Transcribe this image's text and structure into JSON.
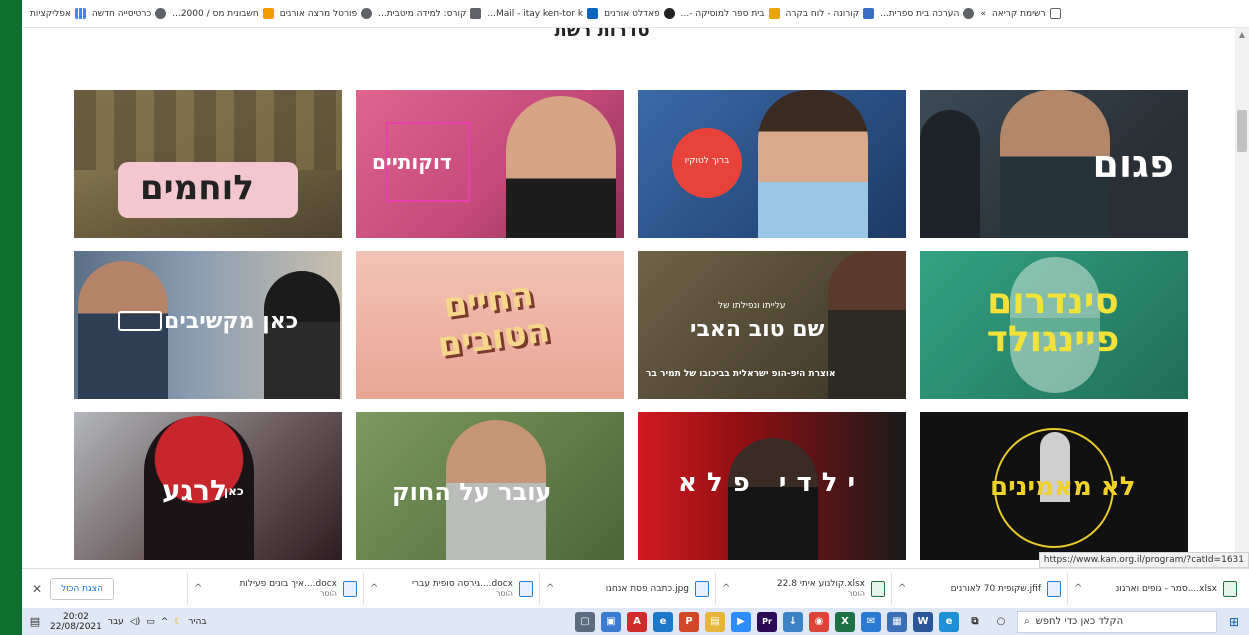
{
  "bookmarks": [
    {
      "label": "אפליקציות",
      "color": "#f4b400"
    },
    {
      "label": "כרטיסייה חדשה",
      "color": "#4285f4"
    },
    {
      "label": "חשבונית מס / 2000...",
      "color": "#f29900"
    },
    {
      "label": "פורטל מרצה אורנים",
      "color": "#5f6368"
    },
    {
      "label": "קורס: למידה מיטבית...",
      "color": "#5f6368"
    },
    {
      "label": "Mail - itay ken-tor k...",
      "color": "#0a64c2"
    },
    {
      "label": "פאדלט אורנים",
      "color": "#222222"
    },
    {
      "label": "בית ספר למוסיקה -...",
      "color": "#e8a400"
    },
    {
      "label": "קורונה - לוח בקרה",
      "color": "#3b6fc4"
    },
    {
      "label": "הערכה בית ספרית...",
      "color": "#5f6368"
    }
  ],
  "bookmarks_more": "»",
  "reading_list": "רשימת קריאה",
  "section_title": "סדרות רשת",
  "tiles": [
    {
      "title": "פגום",
      "bg1": "#3b4b57",
      "bg2": "#2a2f35"
    },
    {
      "title": "ברוך לטוקיו",
      "bg1": "#3a6aa8",
      "bg2": "#1e3a66"
    },
    {
      "title": "דוקותיים",
      "bg1": "#d84f86",
      "bg2": "#222222"
    },
    {
      "title": "לוחמים",
      "bg1": "#8a7b55",
      "bg2": "#5a4d33"
    },
    {
      "title": "סינדרום פיינגולד",
      "bg1": "#2f9a7c",
      "bg2": "#1f6e58"
    },
    {
      "title": "שם טוב האבי",
      "subtitle": "עלייתו ונפילתו של",
      "caption": "אוצרת היפ-הופ ישראלית בביכובו של תמיר בר",
      "bg1": "#6e6247",
      "bg2": "#3a3324"
    },
    {
      "title": "החיים הטובים",
      "bg1": "#f1b9ad",
      "bg2": "#e59b8f"
    },
    {
      "title": "כאן מקשיבים",
      "bg1": "#8ea4bb",
      "bg2": "#3f4f63"
    },
    {
      "title": "לא מאמינים",
      "bg1": "#1b1b1b",
      "bg2": "#0b0b0b"
    },
    {
      "title": "ילדי פלא",
      "bg1": "#c0171c",
      "bg2": "#1a1a1a"
    },
    {
      "title": "עובר על החוק",
      "bg1": "#6d8a53",
      "bg2": "#3e5532"
    },
    {
      "title": "לרגע",
      "prefix": "כאן",
      "bg1": "#8a4b4e",
      "bg2": "#3a2023"
    }
  ],
  "status_url": "https://www.kan.org.il/program/?catId=1631",
  "downloads": [
    {
      "name": "xlsx....סמר - גופים וארגונ",
      "meta": "",
      "type": "xl"
    },
    {
      "name": "jfif.שקופית 70 לאורנים",
      "meta": "",
      "type": "doc"
    },
    {
      "name": "xlsx.קולנוע איתי 22.8",
      "meta": "הוסר",
      "type": "xl"
    },
    {
      "name": "jpg.כתבה פסת אנחנו",
      "meta": "",
      "type": "doc"
    },
    {
      "name": "docx....גירסה סופית עברי",
      "meta": "הוסר",
      "type": "doc"
    },
    {
      "name": "docx....איך בונים פעילות",
      "meta": "הוסר",
      "type": "doc"
    }
  ],
  "show_all_label": "הצגת הכול",
  "close_label": "✕",
  "taskbar": {
    "search_placeholder": "הקלד כאן כדי לחפש",
    "time": "20:02",
    "date": "22/08/2021",
    "lang": "עבר",
    "weather": "בהיר",
    "apps": [
      {
        "icon": "cortana-icon",
        "color": "#6d7c90",
        "label": "○"
      },
      {
        "icon": "task-view-icon",
        "color": "#6d7c90",
        "label": "⧉"
      },
      {
        "icon": "edge-icon",
        "color": "#1f8fd6",
        "label": "e"
      },
      {
        "icon": "word-icon",
        "color": "#2b579a",
        "label": "W"
      },
      {
        "icon": "store-icon",
        "color": "#3a6fb7",
        "label": "▦"
      },
      {
        "icon": "mail-icon",
        "color": "#2a7ad3",
        "label": "✉"
      },
      {
        "icon": "excel-icon",
        "color": "#1e7145",
        "label": "X"
      },
      {
        "icon": "chrome-icon",
        "color": "#db4437",
        "label": "◉"
      },
      {
        "icon": "download-icon",
        "color": "#3b82c4",
        "label": "↓"
      },
      {
        "icon": "premiere-icon",
        "color": "#2c0a55",
        "label": "Pr"
      },
      {
        "icon": "zoom-icon",
        "color": "#2d8cff",
        "label": "▶"
      },
      {
        "icon": "explorer-icon",
        "color": "#e7b43c",
        "label": "▤"
      },
      {
        "icon": "powerpoint-icon",
        "color": "#d24726",
        "label": "P"
      },
      {
        "icon": "ie-icon",
        "color": "#1c78c8",
        "label": "e"
      },
      {
        "icon": "acrobat-icon",
        "color": "#d12c2c",
        "label": "A"
      },
      {
        "icon": "photos-icon",
        "color": "#3b7bd1",
        "label": "▣"
      },
      {
        "icon": "app-icon",
        "color": "#5b6b80",
        "label": "▢"
      }
    ]
  }
}
